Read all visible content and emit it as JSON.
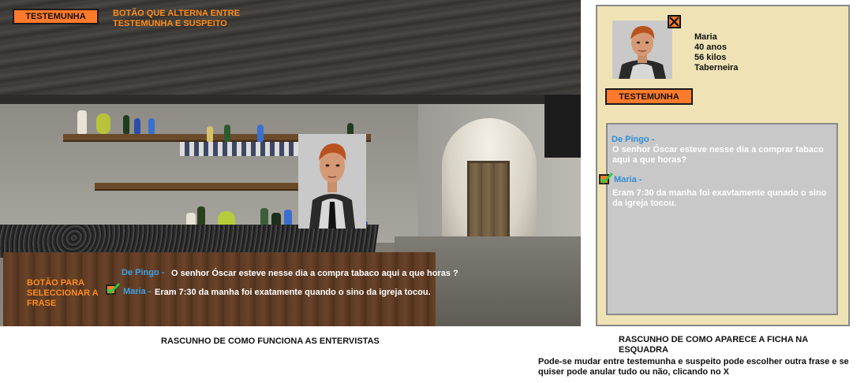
{
  "scene": {
    "toggle_button_label": "TESTEMUNHA",
    "toggle_note": "BOTÃO QUE ALTERNA ENTRE TESTEMUNHA E SUSPEITO",
    "select_note": "BOTÃO PARA SELECCIONAR A FRASE",
    "dialog": [
      {
        "speaker": "De Pingo -",
        "text": "O senhor Óscar esteve nesse dia a compra tabaco aqui a que horas ?"
      },
      {
        "speaker": "Maria -",
        "text": "Eram 7:30 da manha foi exatamente quando o sino da igreja tocou."
      }
    ],
    "caption": "RASCUNHO DE COMO FUNCIONA AS ENTERVISTAS"
  },
  "card": {
    "name": "Maria",
    "age": "40 anos",
    "weight": "56 kilos",
    "job": "Taberneira",
    "toggle_button_label": "TESTEMUNHA",
    "close_icon": "close-x-icon",
    "transcript": [
      {
        "speaker": "De Pingo -",
        "text": "O senhor Óscar esteve nesse dia a comprar tabaco aqui a que horas?"
      },
      {
        "speaker": "Maria -",
        "text": "Eram 7:30 da manha foi exavtamente qunado o sino da igreja tocou."
      }
    ],
    "caption": "RASCUNHO DE COMO APARECE A FICHA NA ESQUADRA",
    "description": "Pode-se mudar entre testemunha e suspeito pode escolher outra frase e se quiser pode anular tudo ou não, clicando no X"
  },
  "colors": {
    "accent_orange": "#ff7a2a",
    "note_orange": "#ff8c1a",
    "speaker_blue": "#3aa3e8",
    "card_bg": "#efe3b6",
    "transcript_bg": "#c8c8c8"
  }
}
